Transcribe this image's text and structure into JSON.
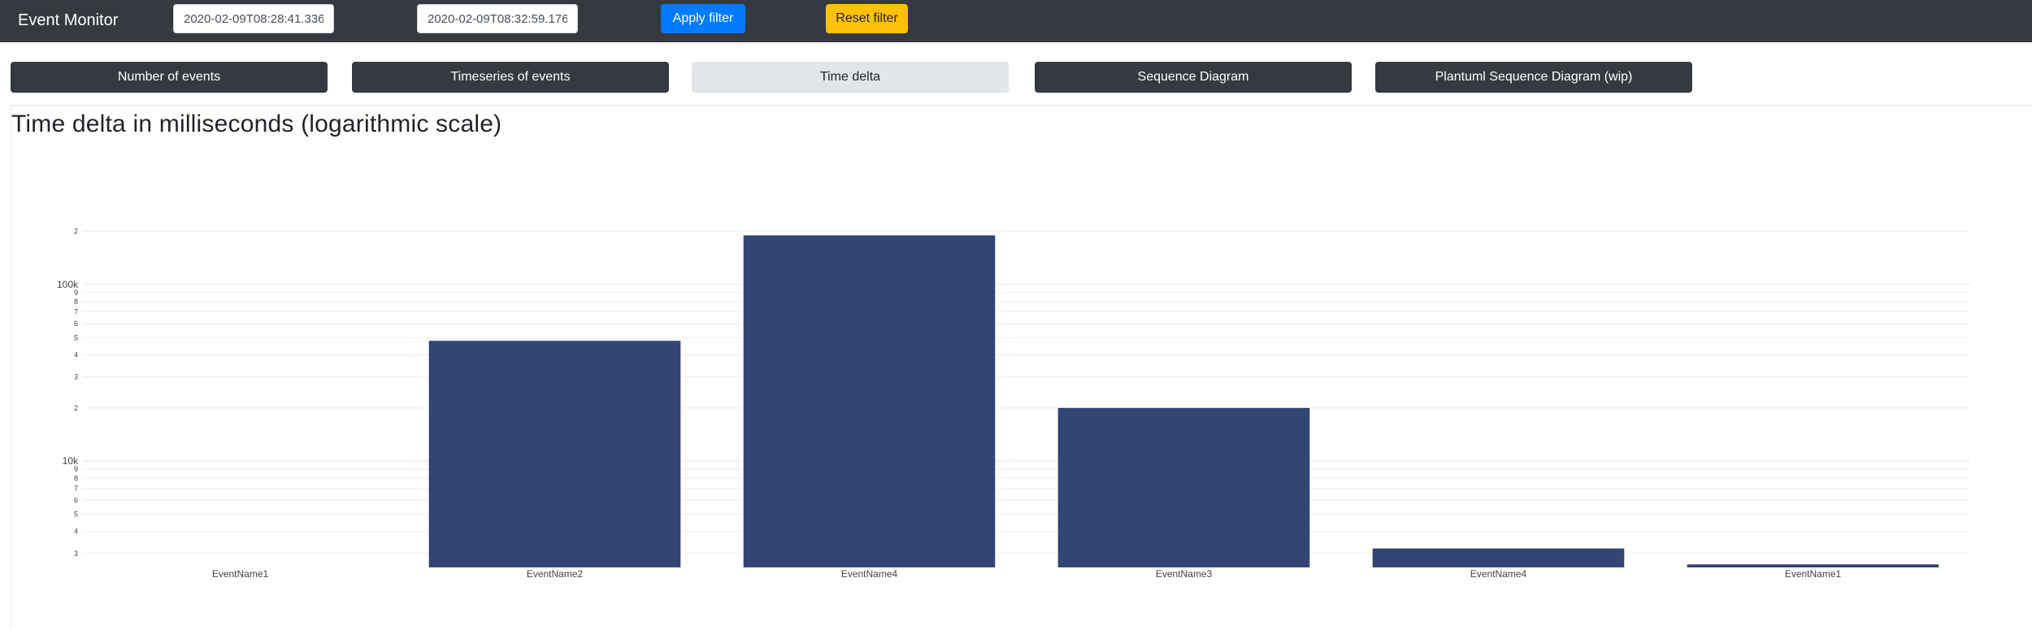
{
  "navbar": {
    "brand": "Event Monitor",
    "start_value": "2020-02-09T08:28:41.336",
    "end_value": "2020-02-09T08:32:59.176",
    "apply_label": "Apply filter",
    "reset_label": "Reset filter"
  },
  "tabs": [
    {
      "label": "Number of events",
      "active": false
    },
    {
      "label": "Timeseries of events",
      "active": false
    },
    {
      "label": "Time delta",
      "active": true
    },
    {
      "label": "Sequence Diagram",
      "active": false
    },
    {
      "label": "Plantuml Sequence Diagram (wip)",
      "active": false
    }
  ],
  "colors": {
    "navbar": "#343a40",
    "primary": "#007bff",
    "warning": "#ffc107",
    "bar": "#324574"
  },
  "chart_data": {
    "type": "bar",
    "title": "Time delta in milliseconds (logarithmic scale)",
    "xlabel": "",
    "ylabel": "",
    "y_scale": "log",
    "ylim": [
      2500,
      210000
    ],
    "grid": true,
    "categories": [
      "EventName1",
      "EventName2",
      "EventName4",
      "EventName3",
      "EventName4",
      "EventName1"
    ],
    "values": [
      2500,
      48000,
      190000,
      20000,
      3200,
      2600
    ],
    "y_ticks": [
      {
        "value": 3000,
        "label": "3"
      },
      {
        "value": 4000,
        "label": "4"
      },
      {
        "value": 5000,
        "label": "5"
      },
      {
        "value": 6000,
        "label": "6"
      },
      {
        "value": 7000,
        "label": "7"
      },
      {
        "value": 8000,
        "label": "8"
      },
      {
        "value": 9000,
        "label": "9"
      },
      {
        "value": 10000,
        "label": "10k"
      },
      {
        "value": 20000,
        "label": "2"
      },
      {
        "value": 30000,
        "label": "3"
      },
      {
        "value": 40000,
        "label": "4"
      },
      {
        "value": 50000,
        "label": "5"
      },
      {
        "value": 60000,
        "label": "6"
      },
      {
        "value": 70000,
        "label": "7"
      },
      {
        "value": 80000,
        "label": "8"
      },
      {
        "value": 90000,
        "label": "9"
      },
      {
        "value": 100000,
        "label": "100k"
      },
      {
        "value": 200000,
        "label": "2"
      }
    ]
  }
}
